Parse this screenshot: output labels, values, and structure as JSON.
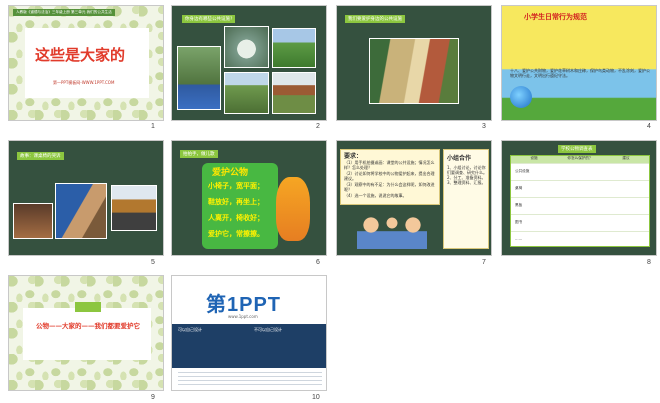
{
  "slides": [
    {
      "number": "1",
      "header": "人教版《道德与法治》三年级上册 第三单元 我们的公共生活",
      "title": "这些是大家的",
      "subtitle": "第一PPT模板网-WWW.1PPT.COM"
    },
    {
      "number": "2",
      "tag": "你身边有哪些公共设施?"
    },
    {
      "number": "3",
      "tag": "我们要爱护身边的公共设施"
    },
    {
      "number": "4",
      "title": "小学生日常行为规范",
      "body": "十八、爱护公共财物，爱护花草树木和庄稼，保护鸟类动物，不乱涂刻，爱护公物文明行走，文明出行遵纪守法。"
    },
    {
      "number": "5",
      "tag": "故事：课桌椅的哭诉"
    },
    {
      "number": "6",
      "tag": "拍拍手，做儿歌",
      "poem_title": "爱护公物",
      "lines": [
        "小椅子，宽平面；",
        "鞋放好，再坐上；",
        "人离开，椅收好；",
        "爱护它，常擦擦。"
      ]
    },
    {
      "number": "7",
      "heading": "要求：",
      "items": [
        "（1）用手机拍摄或画：课堂的公共设施；情况怎么样？怎么处理？",
        "（2）讨论如何将学校中的公物爱护起来，提出合理建议。",
        "（3）观察中的有不足：为什么会这样呢，如何改进呢？",
        "（4）选一个设施，说说它的故事。"
      ],
      "side_heading": "小组合作",
      "side_text": "1、小组讨论，讨论你们要调查、研究什么。2、分工、准备资料。3、整理资料、汇报。"
    },
    {
      "number": "8",
      "tag": "学校公物调查表",
      "columns": [
        "设施",
        "你怎么保护的？",
        "建议"
      ],
      "rows": [
        "公共设施",
        "桌椅",
        "黑板",
        "图书",
        "……"
      ]
    },
    {
      "number": "9",
      "text": "公物——大家的——我们都要爱护它"
    },
    {
      "number": "10",
      "logo": "第1PPT",
      "logo_sub": "www.1ppt.com",
      "left_head": "可以自己设计",
      "right_head": "不可以自己设计"
    }
  ],
  "colors": {
    "slide_green": "#35513f",
    "tag_green": "#8cc63f",
    "title_red": "#e13b2b",
    "ppt_blue": "#1f64b4"
  }
}
